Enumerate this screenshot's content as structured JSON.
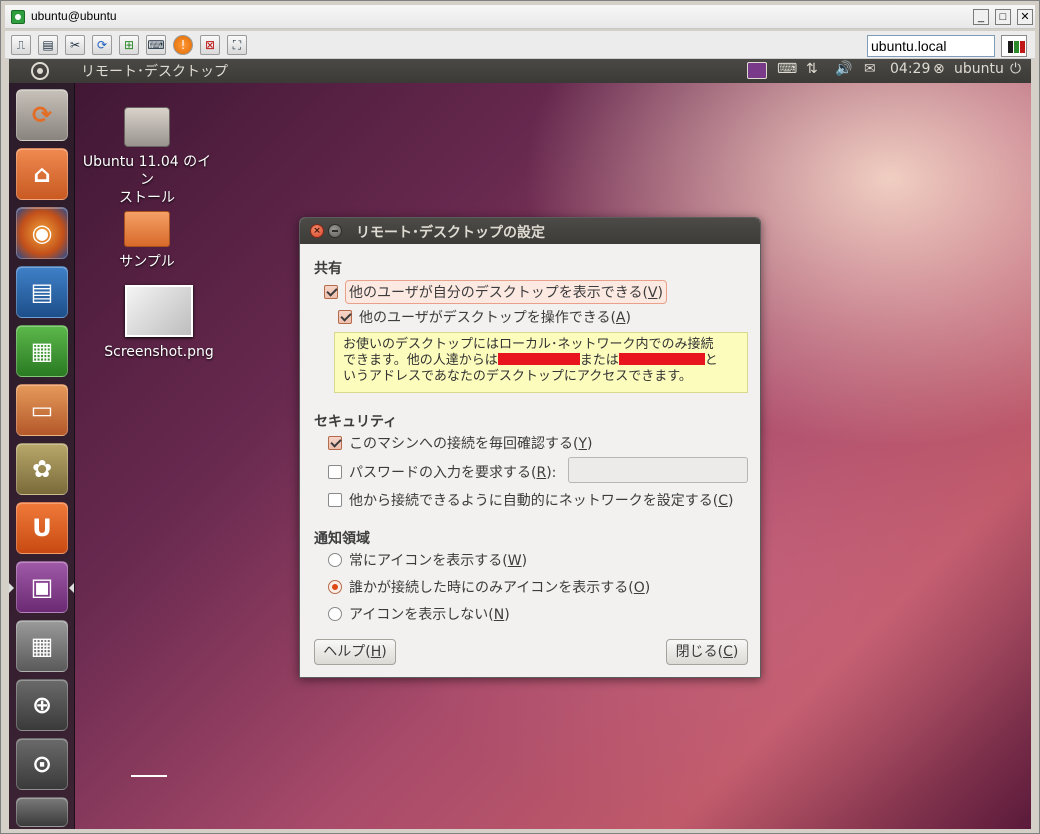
{
  "viewer": {
    "title": "ubuntu@ubuntu",
    "host": "ubuntu.local",
    "toolbar_icons": [
      "monitor-icon",
      "options-icon",
      "tools-icon",
      "refresh-icon",
      "windows-key-icon",
      "keyboard-icon",
      "alert-icon",
      "disconnect-icon",
      "fullscreen-icon"
    ]
  },
  "panel": {
    "app_title": "リモート･デスクトップ",
    "time": "04:29",
    "user": "ubuntu"
  },
  "launcher": {
    "items": [
      "install-icon",
      "home-folder-icon",
      "firefox-icon",
      "writer-icon",
      "calc-icon",
      "impress-icon",
      "software-center-icon",
      "ubuntu-one-icon",
      "remote-desktop-icon",
      "workspaces-icon",
      "zoom-in-icon",
      "search-apps-icon",
      "trash-icon"
    ]
  },
  "desktop": {
    "icons": [
      {
        "line1": "Ubuntu 11.04 のイン",
        "line2": "ストール"
      },
      {
        "line1": "サンプル",
        "line2": ""
      },
      {
        "line1": "Screenshot.png",
        "line2": ""
      }
    ]
  },
  "dialog": {
    "title": "リモート･デスクトップの設定",
    "sharing": {
      "header": "共有",
      "allow_view": {
        "text": "他のユーザが自分のデスクトップを表示できる(",
        "key": "V",
        "tail": ")",
        "checked": true
      },
      "allow_control": {
        "text": "他のユーザがデスクトップを操作できる(",
        "key": "A",
        "tail": ")",
        "checked": true
      },
      "note": {
        "l1": "お使いのデスクトップにはローカル･ネットワーク内でのみ接続",
        "l2a": "できます。他の人達からは",
        "l2b": "または",
        "l2c": "と",
        "l3": "いうアドレスであなたのデスクトップにアクセスできます。"
      }
    },
    "security": {
      "header": "セキュリティ",
      "confirm": {
        "text": "このマシンへの接続を毎回確認する(",
        "key": "Y",
        "tail": ")",
        "checked": true
      },
      "password": {
        "text": "パスワードの入力を要求する(",
        "key": "R",
        "tail": "):",
        "checked": false
      },
      "upnp": {
        "text": "他から接続できるように自動的にネットワークを設定する(",
        "key": "C",
        "tail": ")",
        "checked": false
      }
    },
    "notification": {
      "header": "通知領域",
      "always": {
        "text": "常にアイコンを表示する(",
        "key": "W",
        "tail": ")",
        "selected": false
      },
      "connected": {
        "text": "誰かが接続した時にのみアイコンを表示する(",
        "key": "O",
        "tail": ")",
        "selected": true
      },
      "never": {
        "text": "アイコンを表示しない(",
        "key": "N",
        "tail": ")",
        "selected": false
      }
    },
    "help_button": {
      "text": "ヘルプ(",
      "key": "H",
      "tail": ")"
    },
    "close_button": {
      "text": "閉じる(",
      "key": "C",
      "tail": ")"
    }
  },
  "colors": {
    "accent": "#dd4814",
    "note_bg": "#fcfcbd",
    "redaction": "#e8141e"
  }
}
